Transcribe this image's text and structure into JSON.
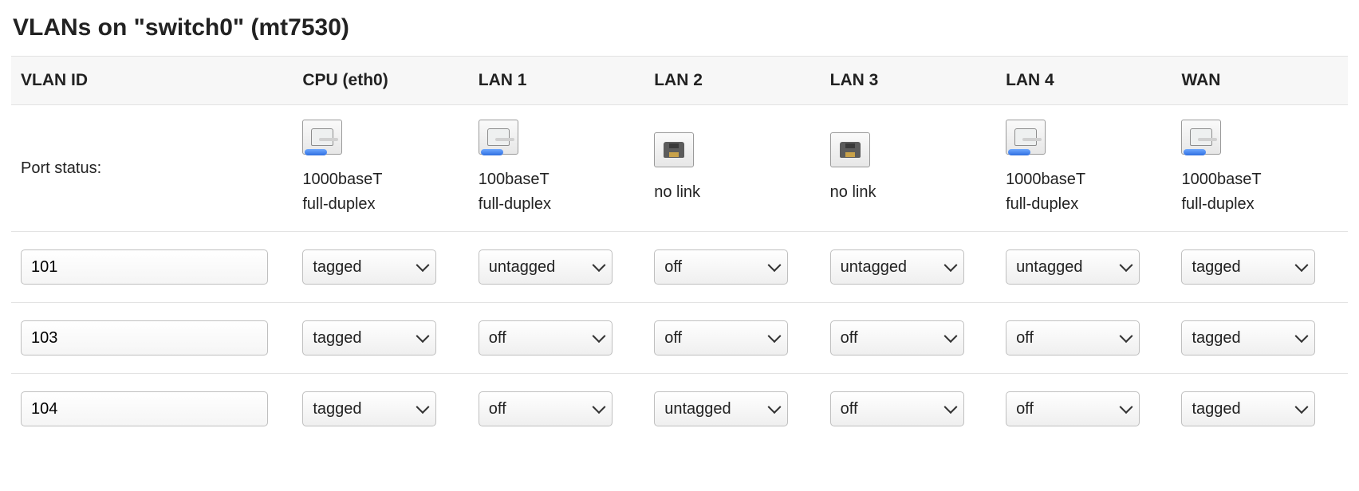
{
  "title": "VLANs on \"switch0\" (mt7530)",
  "columns": [
    "VLAN ID",
    "CPU (eth0)",
    "LAN 1",
    "LAN 2",
    "LAN 3",
    "LAN 4",
    "WAN"
  ],
  "port_status_label": "Port status:",
  "port_status": [
    {
      "link": true,
      "line1": "1000baseT",
      "line2": "full-duplex"
    },
    {
      "link": true,
      "line1": "100baseT",
      "line2": "full-duplex"
    },
    {
      "link": false,
      "line1": "no link",
      "line2": ""
    },
    {
      "link": false,
      "line1": "no link",
      "line2": ""
    },
    {
      "link": true,
      "line1": "1000baseT",
      "line2": "full-duplex"
    },
    {
      "link": true,
      "line1": "1000baseT",
      "line2": "full-duplex"
    }
  ],
  "rows": [
    {
      "id": "101",
      "ports": [
        "tagged",
        "untagged",
        "off",
        "untagged",
        "untagged",
        "tagged"
      ]
    },
    {
      "id": "103",
      "ports": [
        "tagged",
        "off",
        "off",
        "off",
        "off",
        "tagged"
      ]
    },
    {
      "id": "104",
      "ports": [
        "tagged",
        "off",
        "untagged",
        "off",
        "off",
        "tagged"
      ]
    }
  ]
}
